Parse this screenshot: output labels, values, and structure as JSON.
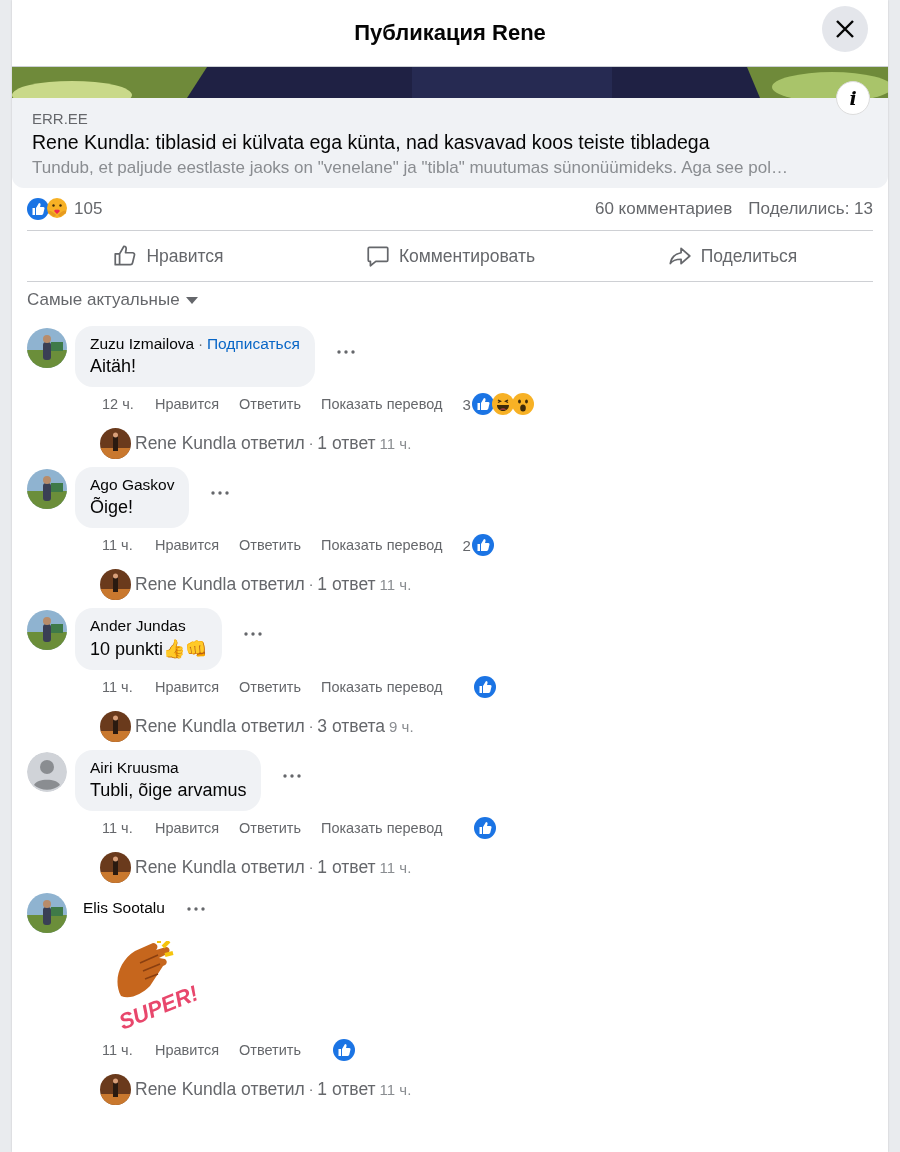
{
  "header": {
    "title": "Публикация Rene"
  },
  "link_card": {
    "kind": "picture",
    "info": "i",
    "source": "ERR.EE",
    "headline": "Rene Kundla: tiblasid ei külvata ega künta, nad kasvavad koos teiste tibladega",
    "snippet": "Tundub, et paljude eestlaste jaoks on \"venelane\" ja \"tibla\" muutumas sünonüümideks. Aga see pol…"
  },
  "stats": {
    "reactions": [
      {
        "kind": "like"
      },
      {
        "kind": "care"
      }
    ],
    "reaction_count": "105",
    "comments": "60 комментариев",
    "shares": "Поделились: 13"
  },
  "actions": [
    {
      "kind": "like",
      "label": "Нравится"
    },
    {
      "kind": "comment",
      "label": "Комментировать"
    },
    {
      "kind": "share",
      "label": "Поделиться"
    }
  ],
  "sort": {
    "label": "Самые актуальные"
  },
  "comments": [
    {
      "avatar": {
        "kind": "picture"
      },
      "name": "Zuzu Izmailova",
      "separator": "·",
      "follow": "Подписаться",
      "kind": "text",
      "text": "Aitäh!",
      "time": "12 ч.",
      "like": "Нравится",
      "reply": "Ответить",
      "translate": "Показать перевод",
      "reaction_count": "3",
      "reactions": [
        {
          "kind": "like"
        },
        {
          "kind": "haha"
        },
        {
          "kind": "wow"
        }
      ],
      "replies": {
        "author": "Rene Kundla ответил",
        "separator": "·",
        "count": "1 ответ",
        "time": "11 ч."
      }
    },
    {
      "avatar": {
        "kind": "picture"
      },
      "name": "Ago Gaskov",
      "kind": "text",
      "text": "Õige!",
      "time": "11 ч.",
      "like": "Нравится",
      "reply": "Ответить",
      "translate": "Показать перевод",
      "reaction_count": "2",
      "reactions": [
        {
          "kind": "like"
        }
      ],
      "replies": {
        "author": "Rene Kundla ответил",
        "separator": "·",
        "count": "1 ответ",
        "time": "11 ч."
      }
    },
    {
      "avatar": {
        "kind": "picture"
      },
      "name": "Ander Jundas",
      "kind": "text",
      "text": "10 punkti👍👊",
      "time": "11 ч.",
      "like": "Нравится",
      "reply": "Ответить",
      "translate": "Показать перевод",
      "reactions": [
        {
          "kind": "like"
        }
      ],
      "replies": {
        "author": "Rene Kundla ответил",
        "separator": "·",
        "count": "3 ответа",
        "time": "9 ч."
      }
    },
    {
      "avatar": {
        "kind": "default"
      },
      "name": "Airi Kruusma",
      "kind": "text",
      "text": "Tubli, õige arvamus",
      "time": "11 ч.",
      "like": "Нравится",
      "reply": "Ответить",
      "translate": "Показать перевод",
      "reactions": [
        {
          "kind": "like"
        }
      ],
      "replies": {
        "author": "Rene Kundla ответил",
        "separator": "·",
        "count": "1 ответ",
        "time": "11 ч."
      }
    },
    {
      "avatar": {
        "kind": "picture"
      },
      "name": "Elis Sootalu",
      "kind": "sticker",
      "text": "SUPER!",
      "time": "11 ч.",
      "like": "Нравится",
      "reply": "Ответить",
      "reactions": [
        {
          "kind": "like"
        }
      ],
      "replies": {
        "author": "Rene Kundla ответил",
        "separator": "·",
        "count": "1 ответ",
        "time": "11 ч."
      }
    }
  ]
}
